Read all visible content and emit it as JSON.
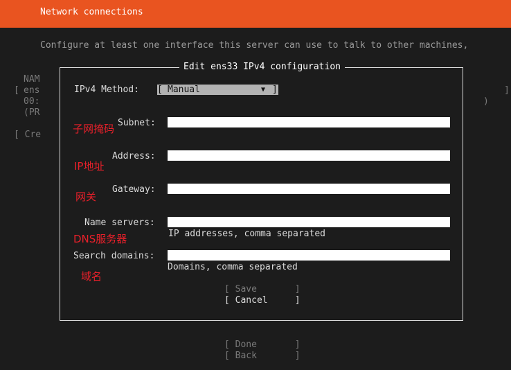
{
  "header": {
    "title": "Network connections"
  },
  "intro": {
    "text": "Configure at least one interface this server can use to talk to other machines,"
  },
  "background": {
    "line1": "NAM",
    "line2_open": "[",
    "line2": "ens",
    "line2_close": "]",
    "line3": "00:",
    "line3_close": ")",
    "line4": "(PR",
    "line5": "[ Cre"
  },
  "dialog": {
    "title": "Edit ens33 IPv4 configuration",
    "method": {
      "label": "IPv4 Method:",
      "bracket_open": "[",
      "value": "Manual",
      "arrow": "▼",
      "bracket_close": "]"
    },
    "fields": {
      "subnet": {
        "label": "Subnet:",
        "value": ""
      },
      "address": {
        "label": "Address:",
        "value": ""
      },
      "gateway": {
        "label": "Gateway:",
        "value": ""
      },
      "name_servers": {
        "label": "Name servers:",
        "value": "",
        "hint": "IP addresses, comma separated"
      },
      "search_domains": {
        "label": "Search domains:",
        "value": "",
        "hint": "Domains, comma separated"
      }
    },
    "buttons": {
      "save": "[ Save       ]",
      "cancel": "[ Cancel     ]"
    }
  },
  "annotations": {
    "subnet": "子网掩码",
    "ip": "IP地址",
    "gateway": "网关",
    "dns": "DNS服务器",
    "domain": "域名"
  },
  "footer": {
    "done": "[ Done       ]",
    "back": "[ Back       ]"
  },
  "colors": {
    "header": "#e95420",
    "background": "#1c1c1c",
    "annotation": "#e8202a"
  }
}
